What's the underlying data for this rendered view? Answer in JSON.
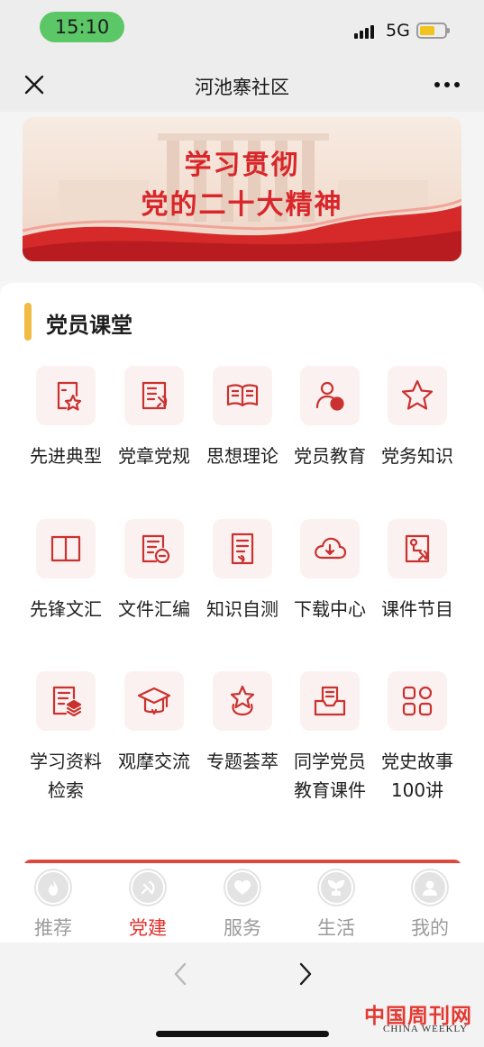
{
  "status_bar": {
    "time": "15:10",
    "network": "5G",
    "battery_level": 0.62
  },
  "nav": {
    "title": "河池寨社区",
    "close_icon": "close-icon",
    "more_icon": "more-icon"
  },
  "banner": {
    "line1": "学习贯彻",
    "line2": "党的二十大精神"
  },
  "section": {
    "title": "党员课堂"
  },
  "menu": [
    {
      "label": "先进典型",
      "icon": "star-frame-icon"
    },
    {
      "label": "党章党规",
      "icon": "party-document-icon"
    },
    {
      "label": "思想理论",
      "icon": "open-book-icon"
    },
    {
      "label": "党员教育",
      "icon": "person-badge-icon"
    },
    {
      "label": "党务知识",
      "icon": "star-outline-icon"
    },
    {
      "label": "先锋文汇",
      "icon": "book-icon"
    },
    {
      "label": "文件汇编",
      "icon": "party-file-icon"
    },
    {
      "label": "知识自测",
      "icon": "test-paper-icon"
    },
    {
      "label": "下载中心",
      "icon": "cloud-download-icon"
    },
    {
      "label": "课件节目",
      "icon": "courseware-icon"
    },
    {
      "label": "学习资料检索",
      "icon": "search-document-icon"
    },
    {
      "label": "观摩交流",
      "icon": "graduation-cap-icon"
    },
    {
      "label": "专题荟萃",
      "icon": "star-medal-icon"
    },
    {
      "label": "同学党员教育课件",
      "icon": "inbox-document-icon"
    },
    {
      "label": "党史故事100讲",
      "icon": "grid-apps-icon"
    }
  ],
  "tabs": [
    {
      "label": "推荐",
      "icon": "flame-icon",
      "active": false
    },
    {
      "label": "党建",
      "icon": "party-emblem-icon",
      "active": true
    },
    {
      "label": "服务",
      "icon": "heart-hands-icon",
      "active": false
    },
    {
      "label": "生活",
      "icon": "sprout-icon",
      "active": false
    },
    {
      "label": "我的",
      "icon": "user-icon",
      "active": false
    }
  ],
  "browser": {
    "back_icon": "chevron-left-icon",
    "forward_icon": "chevron-right-icon"
  },
  "watermark": {
    "cn": "中国周刊网",
    "en": "CHINA WEEKLY"
  },
  "colors": {
    "accent_red": "#d9262a",
    "tile_bg": "#fcf1f1",
    "section_bar": "#f1bc43",
    "status_green": "#5cc767"
  }
}
